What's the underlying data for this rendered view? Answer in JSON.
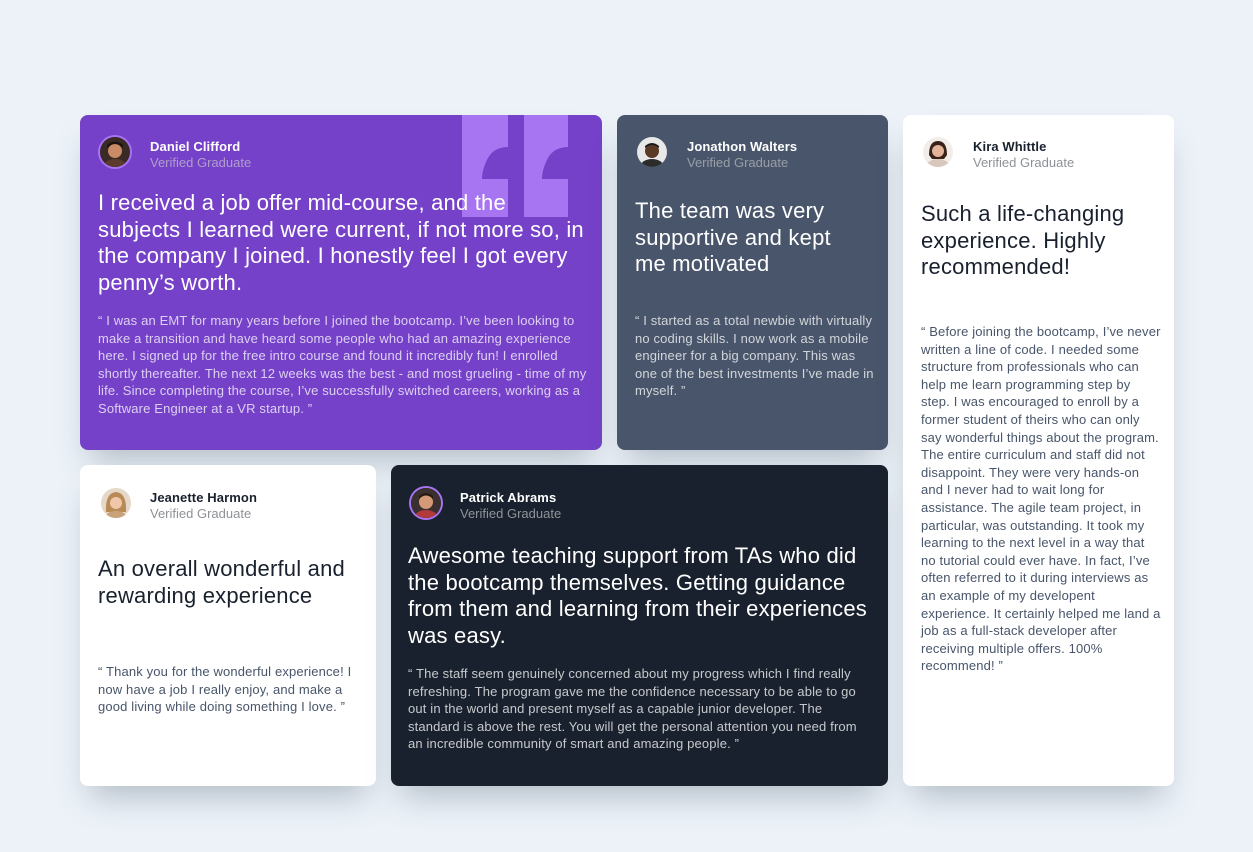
{
  "verified_label": "Verified Graduate",
  "colors": {
    "background": "#ecf2f8",
    "purple": "#7541c8",
    "slate": "#48556a",
    "dark": "#19212e",
    "white": "#ffffff",
    "quote_mark": "#a775f1"
  },
  "testimonials": [
    {
      "name": "Daniel Clifford",
      "role": "Verified Graduate",
      "headline": "I received a job offer mid-course, and the subjects I learned were current, if not more so, in the company I joined. I honestly feel I got every penny’s worth.",
      "body": "“ I was an EMT for many years before I joined the bootcamp. I’ve been looking to make a transition and have heard some people who had an amazing experience here. I signed up for the free intro course and found it incredibly fun! I enrolled shortly thereafter. The next 12 weeks was the best - and most grueling - time of my life. Since completing the course, I’ve successfully switched careers, working as a Software Engineer at a VR startup. ”"
    },
    {
      "name": "Jonathon Walters",
      "role": "Verified Graduate",
      "headline": "The team was very supportive and kept me motivated",
      "body": "“ I started as a total newbie with virtually no coding skills. I now work as a mobile engineer for a big company. This was one of the best investments I’ve made in myself. ”"
    },
    {
      "name": "Kira Whittle",
      "role": "Verified Graduate",
      "headline": "Such a life-changing experience. Highly recommended!",
      "body": "“ Before joining the bootcamp, I’ve never written a line of code. I needed some structure from professionals who can help me learn programming step by step. I was encouraged to enroll by a former student of theirs who can only say wonderful things about the program. The entire curriculum and staff did not disappoint. They were very hands-on and I never had to wait long for assistance. The agile team project, in particular, was outstanding. It took my learning to the next level in a way that no tutorial could ever have. In fact, I’ve often referred to it during interviews as an example of my developent experience. It certainly helped me land a job as a full-stack developer after receiving multiple offers. 100% recommend! ”"
    },
    {
      "name": "Jeanette Harmon",
      "role": "Verified Graduate",
      "headline": "An overall wonderful and rewarding experience",
      "body": "“ Thank you for the wonderful experience! I now have a job I really enjoy, and make a good living while doing something I love. ”"
    },
    {
      "name": "Patrick Abrams",
      "role": "Verified Graduate",
      "headline": "Awesome teaching support from TAs who did the bootcamp themselves. Getting guidance from them and learning from their experiences was easy.",
      "body": "“ The staff seem genuinely concerned about my progress which I find really refreshing. The program gave me the confidence necessary to be able to go out in the world and present myself as a capable junior developer. The standard is above the rest. You will get the personal attention you need from an incredible community of smart and amazing people. ”"
    }
  ]
}
